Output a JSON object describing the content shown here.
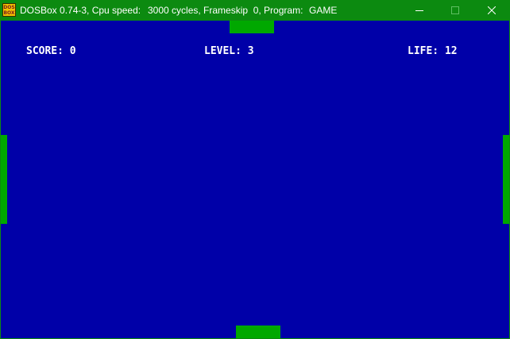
{
  "window": {
    "icon_text": "DOS BOX",
    "title_app": "DOSBox 0.74-3, Cpu speed:",
    "title_cycles": "3000 cycles, Frameskip  0, Program:",
    "title_program": "GAME"
  },
  "controls": {
    "minimize": "minimize-icon",
    "maximize": "maximize-icon",
    "close": "close-icon"
  },
  "colors": {
    "titlebar": "#0c8a10",
    "screen": "#0000a8",
    "paddle": "#00a800",
    "hud_text": "#ffffff"
  },
  "game": {
    "score_text": "SCORE: 0",
    "level_text": "LEVEL: 3",
    "life_text": "LIFE: 12"
  }
}
